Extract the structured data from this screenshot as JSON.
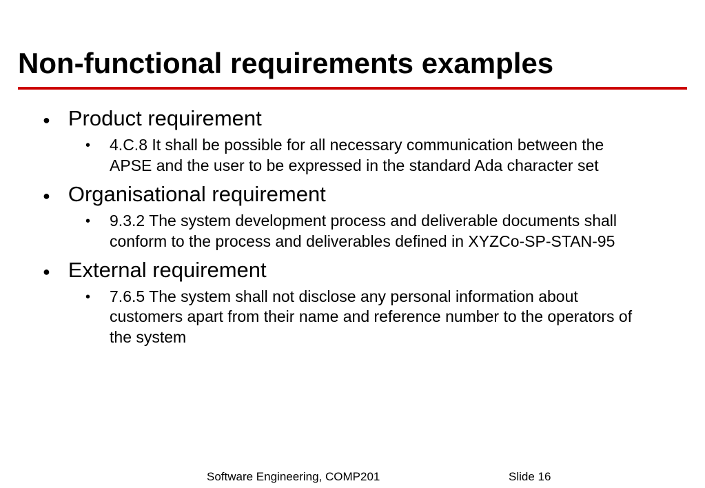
{
  "title": "Non-functional requirements examples",
  "bullets": [
    {
      "label": "Product requirement",
      "sub": "4.C.8 It shall be possible for all necessary communication between the APSE and the user to be expressed in the standard Ada character set"
    },
    {
      "label": "Organisational requirement",
      "sub": "9.3.2  The system development process and deliverable documents shall conform to the process and deliverables defined in XYZCo-SP-STAN-95"
    },
    {
      "label": "External requirement",
      "sub": "7.6.5  The system shall not disclose any personal information about customers apart from their name and reference number to the operators of the system"
    }
  ],
  "footer": {
    "course": "Software Engineering, COMP201",
    "slide_label": "Slide  16"
  }
}
